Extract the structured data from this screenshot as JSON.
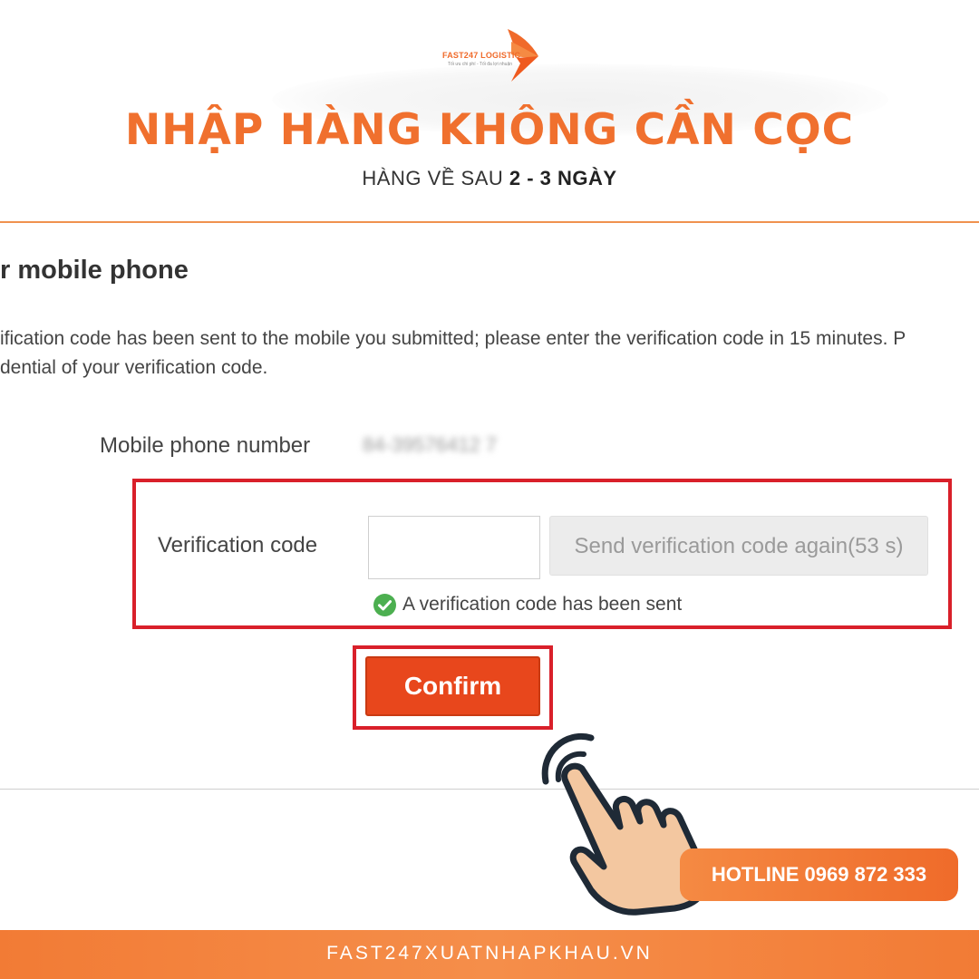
{
  "brand": {
    "logo_text": "FAST247 LOGISTIC",
    "logo_tagline": "Tối ưu chi phí - Tối đa lợi nhuận",
    "accent_color": "#f0702e"
  },
  "header": {
    "headline": "NHẬP HÀNG KHÔNG CẦN CỌC",
    "subline_prefix": "HÀNG VỀ SAU ",
    "subline_bold": "2 - 3 NGÀY"
  },
  "screenshot": {
    "title": "r mobile phone",
    "description_line1": "ification code has been sent to the mobile you submitted; please enter the verification code in 15 minutes. P",
    "description_line2": "dential of your verification code.",
    "phone_label": "Mobile phone number",
    "phone_value": "84-39576412 7",
    "code_label": "Verification code",
    "code_value": "",
    "resend_button": "Send verification code again(53 s)",
    "sent_status": "A verification code has been sent",
    "confirm_button": "Confirm",
    "highlight_color": "#d9202a",
    "confirm_color": "#e8471c"
  },
  "hotline": "HOTLINE 0969 872 333",
  "footer": {
    "website": "FAST247XUATNHAPKHAU.VN"
  },
  "icons": [
    "logo-wing-icon",
    "check-circle-icon",
    "pointing-hand-icon"
  ]
}
